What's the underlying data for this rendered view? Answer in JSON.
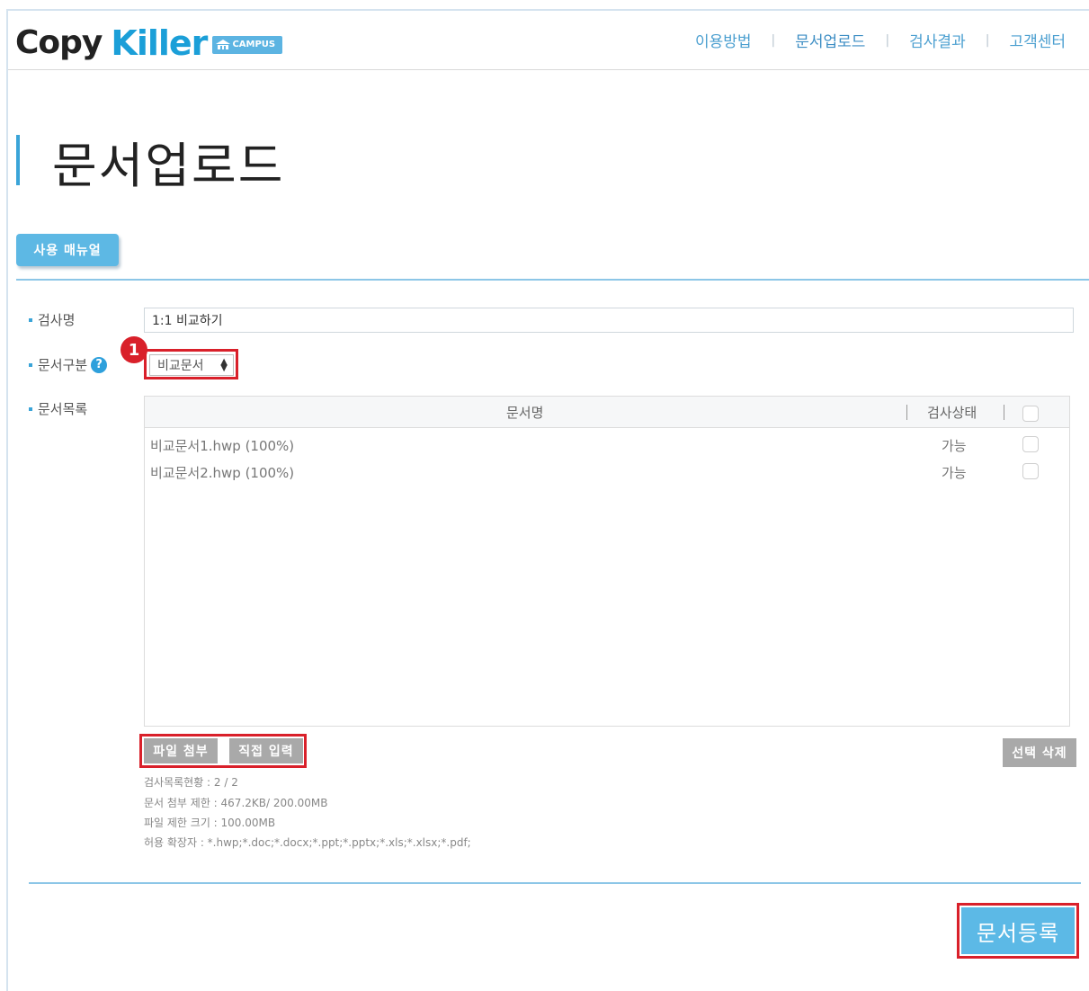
{
  "brand": {
    "copy": "Copy",
    "killer": "Killer",
    "badge": "CAMPUS"
  },
  "nav": {
    "items": [
      "이용방법",
      "문서업로드",
      "검사결과",
      "고객센터"
    ],
    "active": "문서업로드"
  },
  "page": {
    "title": "문서업로드",
    "manual_button": "사용 매뉴얼"
  },
  "form": {
    "exam_name_label": "검사명",
    "exam_name_value": "1:1 비교하기",
    "doc_type_label": "문서구분",
    "doc_type_selected": "비교문서",
    "doc_list_label": "문서목록",
    "step_badge": "1"
  },
  "table": {
    "columns": [
      "문서명",
      "검사상태"
    ],
    "rows": [
      {
        "name": "비교문서1.hwp (100%)",
        "status": "가능"
      },
      {
        "name": "비교문서2.hwp (100%)",
        "status": "가능"
      }
    ]
  },
  "actions": {
    "attach_file": "파일 첨부",
    "direct_input": "직접 입력",
    "delete_selected": "선택 삭제",
    "register": "문서등록"
  },
  "info": {
    "count": "검사목록현황 : 2 / 2",
    "attach_limit": "문서 첨부 제한 : 467.2KB/ 200.00MB",
    "file_size_limit": "파일 제한 크기 : 100.00MB",
    "extensions": "허용 확장자 : *.hwp;*.doc;*.docx;*.ppt;*.pptx;*.xls;*.xlsx;*.pdf;"
  },
  "colors": {
    "accent": "#3aa4d8",
    "highlight": "#d9202a",
    "button_gray": "#a9a9a9"
  }
}
